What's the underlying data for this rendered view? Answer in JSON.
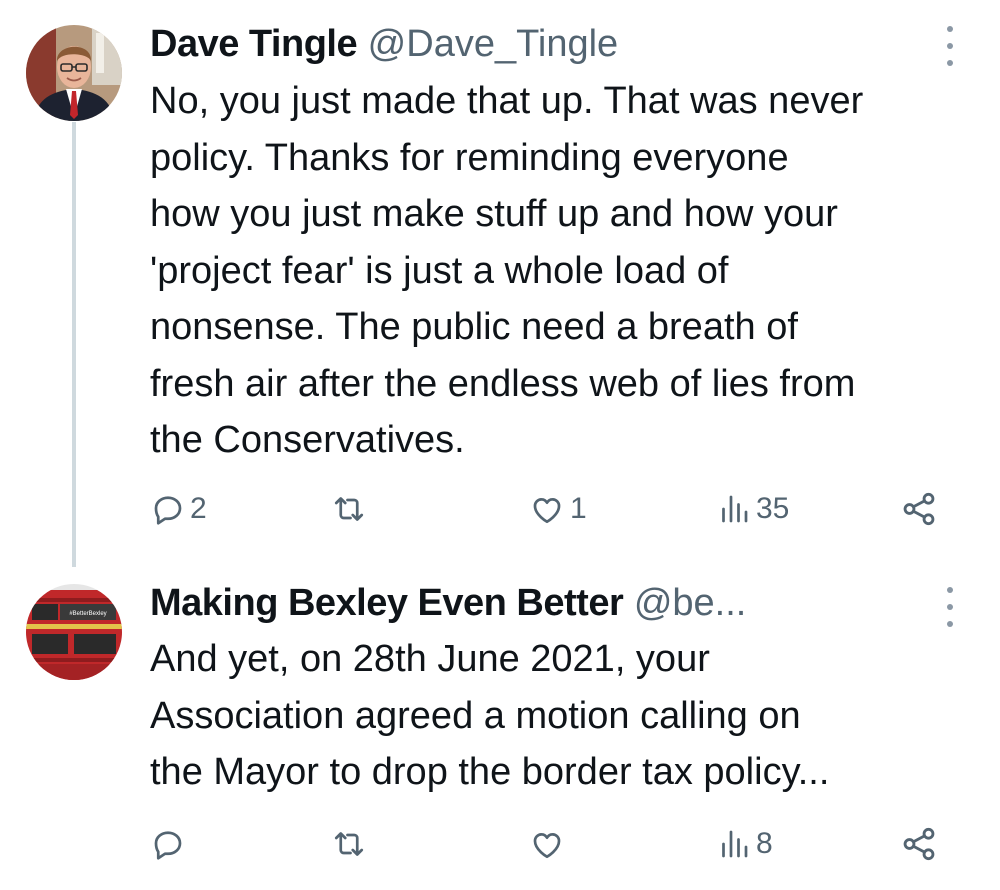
{
  "tweets": [
    {
      "author": {
        "name": "Dave Tingle",
        "handle": "@Dave_Tingle"
      },
      "text": "No, you just made that up. That was never\npolicy. Thanks for reminding everyone\nhow you just make stuff up and how your\n'project fear' is just a whole load of\nnonsense. The public need a breath of\nfresh air after the endless web of lies from\nthe Conservatives.",
      "stats": {
        "replies": "2",
        "reposts": "",
        "likes": "1",
        "views": "35"
      }
    },
    {
      "author": {
        "name": "Making Bexley Even Better",
        "handle": "@be..."
      },
      "avatar_text": "#BetterBexley",
      "text": "And yet, on 28th June 2021, your\nAssociation agreed a motion calling on\nthe Mayor to drop the border tax policy...",
      "stats": {
        "replies": "",
        "reposts": "",
        "likes": "",
        "views": "8"
      }
    }
  ],
  "colors": {
    "text": "#0f1419",
    "secondary": "#536471",
    "thread_line": "#cfd9de",
    "bus_red": "#c0282a"
  },
  "icons": [
    "reply-icon",
    "repost-icon",
    "like-icon",
    "views-icon",
    "share-icon",
    "more-icon"
  ]
}
